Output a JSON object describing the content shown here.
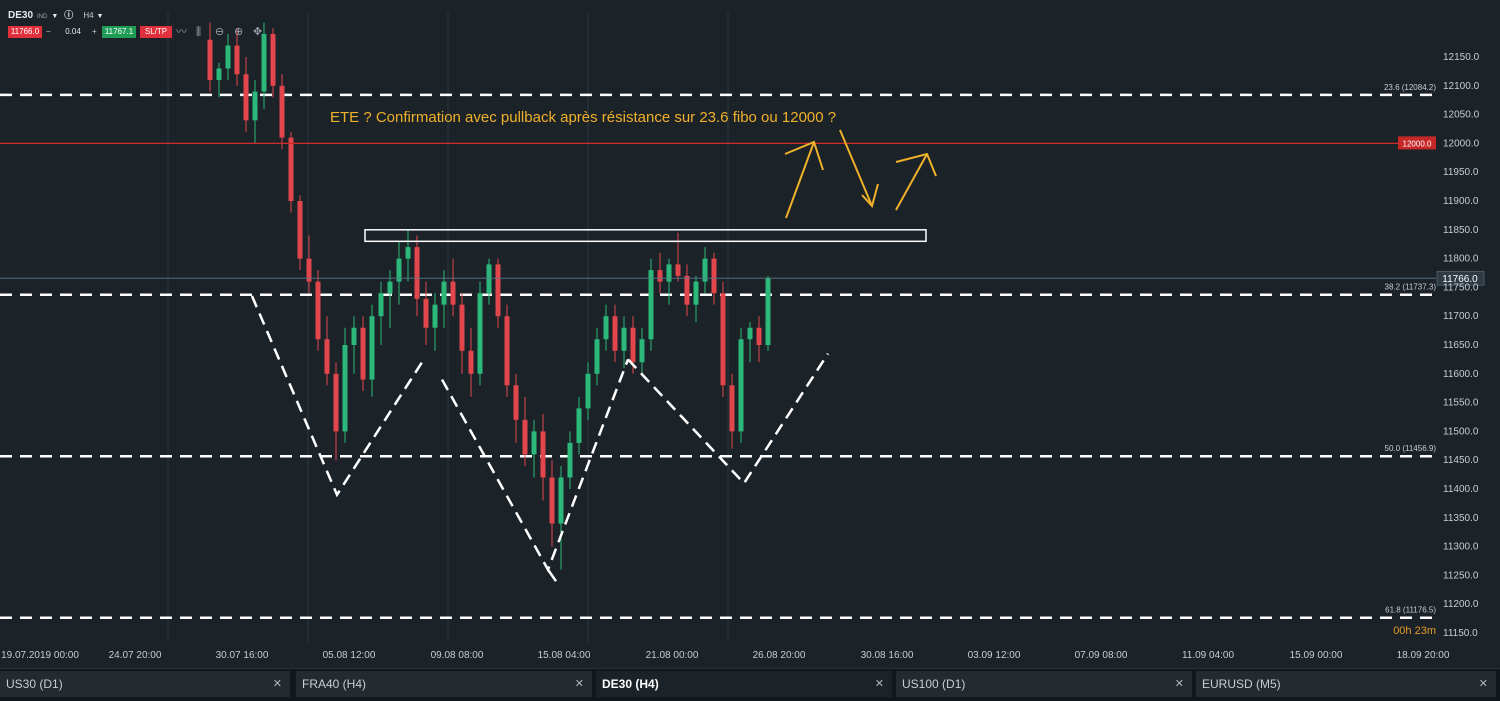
{
  "symbol": {
    "name": "DE30",
    "badge": "IND",
    "timeframe": "H4"
  },
  "trade": {
    "sell_price": "11766.0",
    "quantity": "0.04",
    "buy_price": "11767.1",
    "sltp_label": "SL/TP",
    "minus": "−",
    "plus": "+"
  },
  "toolbar_icons": [
    "line-chart-icon",
    "candles-icon",
    "zoom-out-icon",
    "zoom-in-icon",
    "crosshair-icon"
  ],
  "countdown": "00h 23m",
  "annotation": "ETE ? Confirmation avec pullback après résistance sur 23.6 fibo ou 12000 ?",
  "tabs": [
    {
      "label": "US30 (D1)",
      "active": false
    },
    {
      "label": "FRA40 (H4)",
      "active": false
    },
    {
      "label": "DE30 (H4)",
      "active": true
    },
    {
      "label": "US100 (D1)",
      "active": false
    },
    {
      "label": "EURUSD (M5)",
      "active": false
    }
  ],
  "colors": {
    "background": "#1b2228",
    "bull": "#2bb87a",
    "bear": "#e0464c",
    "resistance": "#d32b2b",
    "annotation": "#f0b12a",
    "fib": "#ffffff"
  },
  "chart_data": {
    "type": "candlestick",
    "symbol": "DE30",
    "timeframe": "H4",
    "ylim": [
      11130,
      12200
    ],
    "y_ticks": [
      11150,
      11200,
      11250,
      11300,
      11350,
      11400,
      11450,
      11500,
      11550,
      11600,
      11650,
      11700,
      11750,
      11800,
      11850,
      11900,
      11950,
      12000,
      12050,
      12100,
      12150
    ],
    "y_tick_labels": [
      "11150.0",
      "11200.0",
      "11250.0",
      "11300.0",
      "11350.0",
      "11400.0",
      "11450.0",
      "11500.0",
      "11550.0",
      "11600.0",
      "11650.0",
      "11700.0",
      "11750.0",
      "11800.0",
      "11850.0",
      "11900.0",
      "11950.0",
      "12000.0",
      "12050.0",
      "12100.0",
      "12150.0"
    ],
    "x_labels": [
      "19.07.2019 00:00",
      "24.07 20:00",
      "30.07 16:00",
      "05.08 12:00",
      "09.08 08:00",
      "15.08 04:00",
      "21.08 00:00",
      "26.08 20:00",
      "30.08 16:00",
      "03.09 12:00",
      "07.09 08:00",
      "11.09 04:00",
      "15.09 00:00",
      "18.09 20:00"
    ],
    "current_price": 11766.0,
    "current_price_label": "11766.0",
    "resistance": {
      "value": 12000.0,
      "label": "12000.0"
    },
    "fib_levels": [
      {
        "label": "23.6 (12084.2)",
        "value": 12084.2
      },
      {
        "label": "38.2 (11737.3)",
        "value": 11737.3
      },
      {
        "label": "50.0 (11456.9)",
        "value": 11456.9
      },
      {
        "label": "61.8 (11176.5)",
        "value": 11176.5
      }
    ],
    "resistance_zone": [
      11830,
      11850
    ],
    "hs_pattern": [
      [
        11735,
        11390,
        11620
      ],
      [
        11590,
        11260,
        11625
      ],
      [
        11625,
        11410,
        11635
      ]
    ],
    "candles": [
      [
        12180,
        12210,
        12090,
        12110
      ],
      [
        12110,
        12140,
        12080,
        12130
      ],
      [
        12130,
        12190,
        12110,
        12170
      ],
      [
        12170,
        12200,
        12100,
        12120
      ],
      [
        12120,
        12150,
        12020,
        12040
      ],
      [
        12040,
        12110,
        12000,
        12090
      ],
      [
        12090,
        12210,
        12060,
        12190
      ],
      [
        12190,
        12200,
        12080,
        12100
      ],
      [
        12100,
        12120,
        11990,
        12010
      ],
      [
        12010,
        12020,
        11880,
        11900
      ],
      [
        11900,
        11910,
        11780,
        11800
      ],
      [
        11800,
        11840,
        11740,
        11760
      ],
      [
        11760,
        11780,
        11640,
        11660
      ],
      [
        11660,
        11700,
        11580,
        11600
      ],
      [
        11600,
        11620,
        11450,
        11500
      ],
      [
        11500,
        11680,
        11480,
        11650
      ],
      [
        11650,
        11700,
        11600,
        11680
      ],
      [
        11680,
        11700,
        11570,
        11590
      ],
      [
        11590,
        11720,
        11560,
        11700
      ],
      [
        11700,
        11760,
        11650,
        11740
      ],
      [
        11740,
        11780,
        11680,
        11760
      ],
      [
        11760,
        11830,
        11720,
        11800
      ],
      [
        11800,
        11850,
        11760,
        11820
      ],
      [
        11820,
        11840,
        11700,
        11730
      ],
      [
        11730,
        11760,
        11650,
        11680
      ],
      [
        11680,
        11740,
        11640,
        11720
      ],
      [
        11720,
        11780,
        11680,
        11760
      ],
      [
        11760,
        11800,
        11700,
        11720
      ],
      [
        11720,
        11740,
        11600,
        11640
      ],
      [
        11640,
        11680,
        11560,
        11600
      ],
      [
        11600,
        11760,
        11580,
        11740
      ],
      [
        11740,
        11800,
        11720,
        11790
      ],
      [
        11790,
        11800,
        11680,
        11700
      ],
      [
        11700,
        11720,
        11560,
        11580
      ],
      [
        11580,
        11600,
        11480,
        11520
      ],
      [
        11520,
        11560,
        11440,
        11460
      ],
      [
        11460,
        11520,
        11420,
        11500
      ],
      [
        11500,
        11530,
        11380,
        11420
      ],
      [
        11420,
        11450,
        11300,
        11340
      ],
      [
        11340,
        11440,
        11260,
        11420
      ],
      [
        11420,
        11500,
        11400,
        11480
      ],
      [
        11480,
        11560,
        11460,
        11540
      ],
      [
        11540,
        11620,
        11520,
        11600
      ],
      [
        11600,
        11680,
        11580,
        11660
      ],
      [
        11660,
        11720,
        11640,
        11700
      ],
      [
        11700,
        11720,
        11620,
        11640
      ],
      [
        11640,
        11700,
        11610,
        11680
      ],
      [
        11680,
        11700,
        11600,
        11620
      ],
      [
        11620,
        11680,
        11600,
        11660
      ],
      [
        11660,
        11800,
        11640,
        11780
      ],
      [
        11780,
        11810,
        11740,
        11760
      ],
      [
        11760,
        11800,
        11720,
        11790
      ],
      [
        11790,
        11845,
        11760,
        11770
      ],
      [
        11770,
        11790,
        11700,
        11720
      ],
      [
        11720,
        11770,
        11690,
        11760
      ],
      [
        11760,
        11820,
        11740,
        11800
      ],
      [
        11800,
        11810,
        11720,
        11740
      ],
      [
        11740,
        11760,
        11560,
        11580
      ],
      [
        11580,
        11600,
        11470,
        11500
      ],
      [
        11500,
        11680,
        11480,
        11660
      ],
      [
        11660,
        11690,
        11620,
        11680
      ],
      [
        11680,
        11700,
        11620,
        11650
      ],
      [
        11650,
        11770,
        11640,
        11766
      ]
    ]
  }
}
